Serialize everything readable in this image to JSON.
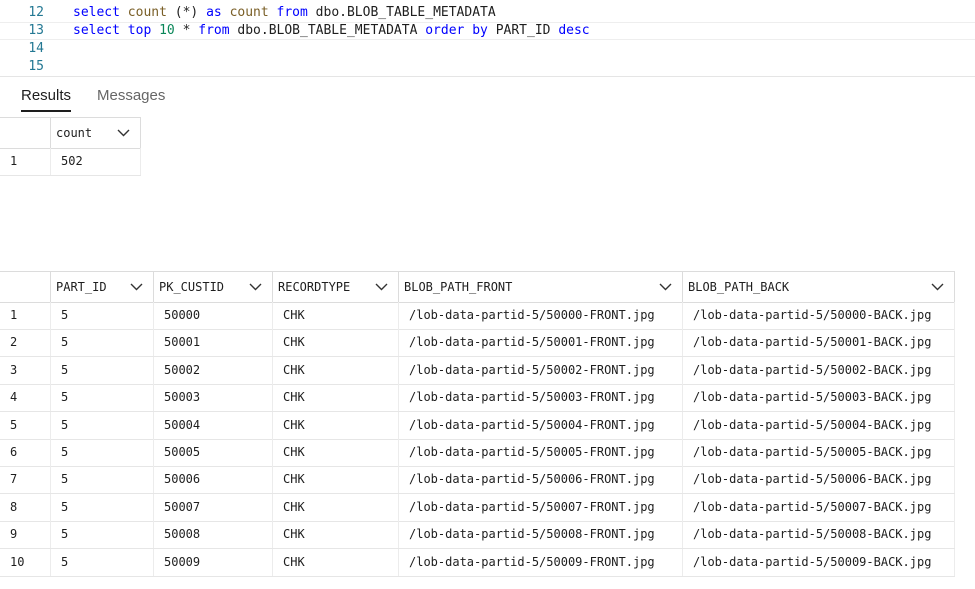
{
  "editor": {
    "lines": [
      {
        "num": "12",
        "parts": [
          [
            "kw",
            "select "
          ],
          [
            "fn",
            "count"
          ],
          [
            "txt",
            " (*) "
          ],
          [
            "kw",
            "as "
          ],
          [
            "fn",
            "count "
          ],
          [
            "kw",
            "from "
          ],
          [
            "txt",
            "dbo.BLOB_TABLE_METADATA"
          ]
        ]
      },
      {
        "num": "13",
        "parts": [
          [
            "kw",
            "select "
          ],
          [
            "kw",
            "top "
          ],
          [
            "num",
            "10 "
          ],
          [
            "txt",
            "* "
          ],
          [
            "kw",
            "from "
          ],
          [
            "txt",
            "dbo.BLOB_TABLE_METADATA "
          ],
          [
            "kw",
            "order by "
          ],
          [
            "txt",
            "PART_ID "
          ],
          [
            "kw",
            "desc"
          ]
        ]
      },
      {
        "num": "14",
        "parts": []
      },
      {
        "num": "15",
        "parts": []
      }
    ]
  },
  "tabs": {
    "results": "Results",
    "messages": "Messages"
  },
  "grid1": {
    "columns": [
      "count"
    ],
    "rows": [
      [
        "1",
        "502"
      ]
    ]
  },
  "grid2": {
    "columns": [
      "PART_ID",
      "PK_CUSTID",
      "RECORDTYPE",
      "BLOB_PATH_FRONT",
      "BLOB_PATH_BACK"
    ],
    "rows": [
      [
        "1",
        "5",
        "50000",
        "CHK",
        "/lob-data-partid-5/50000-FRONT.jpg",
        "/lob-data-partid-5/50000-BACK.jpg"
      ],
      [
        "2",
        "5",
        "50001",
        "CHK",
        "/lob-data-partid-5/50001-FRONT.jpg",
        "/lob-data-partid-5/50001-BACK.jpg"
      ],
      [
        "3",
        "5",
        "50002",
        "CHK",
        "/lob-data-partid-5/50002-FRONT.jpg",
        "/lob-data-partid-5/50002-BACK.jpg"
      ],
      [
        "4",
        "5",
        "50003",
        "CHK",
        "/lob-data-partid-5/50003-FRONT.jpg",
        "/lob-data-partid-5/50003-BACK.jpg"
      ],
      [
        "5",
        "5",
        "50004",
        "CHK",
        "/lob-data-partid-5/50004-FRONT.jpg",
        "/lob-data-partid-5/50004-BACK.jpg"
      ],
      [
        "6",
        "5",
        "50005",
        "CHK",
        "/lob-data-partid-5/50005-FRONT.jpg",
        "/lob-data-partid-5/50005-BACK.jpg"
      ],
      [
        "7",
        "5",
        "50006",
        "CHK",
        "/lob-data-partid-5/50006-FRONT.jpg",
        "/lob-data-partid-5/50006-BACK.jpg"
      ],
      [
        "8",
        "5",
        "50007",
        "CHK",
        "/lob-data-partid-5/50007-FRONT.jpg",
        "/lob-data-partid-5/50007-BACK.jpg"
      ],
      [
        "9",
        "5",
        "50008",
        "CHK",
        "/lob-data-partid-5/50008-FRONT.jpg",
        "/lob-data-partid-5/50008-BACK.jpg"
      ],
      [
        "10",
        "5",
        "50009",
        "CHK",
        "/lob-data-partid-5/50009-FRONT.jpg",
        "/lob-data-partid-5/50009-BACK.jpg"
      ]
    ]
  },
  "icons": {
    "sort": "chevron-down-icon"
  }
}
